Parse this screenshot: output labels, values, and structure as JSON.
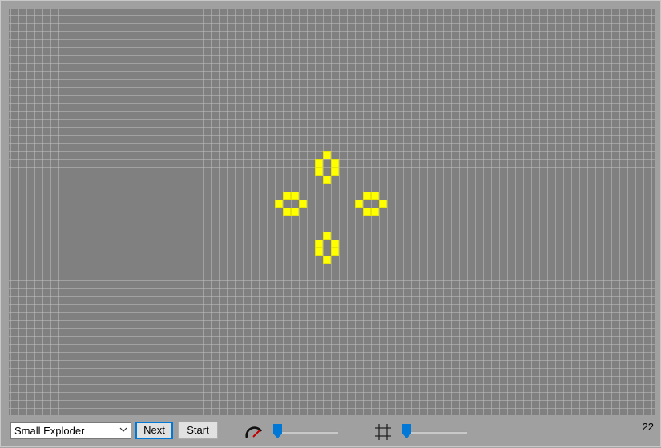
{
  "board": {
    "live_cell_color": "#ffff00",
    "background_color": "#808080",
    "grid_line_color": "#bebebe",
    "live_cells": [
      [
        40,
        18
      ],
      [
        39,
        19
      ],
      [
        41,
        19
      ],
      [
        39,
        20
      ],
      [
        41,
        20
      ],
      [
        40,
        21
      ],
      [
        35,
        23
      ],
      [
        36,
        23
      ],
      [
        45,
        23
      ],
      [
        46,
        23
      ],
      [
        34,
        24
      ],
      [
        37,
        24
      ],
      [
        44,
        24
      ],
      [
        47,
        24
      ],
      [
        35,
        25
      ],
      [
        36,
        25
      ],
      [
        45,
        25
      ],
      [
        46,
        25
      ],
      [
        40,
        28
      ],
      [
        39,
        29
      ],
      [
        41,
        29
      ],
      [
        39,
        30
      ],
      [
        41,
        30
      ],
      [
        40,
        31
      ]
    ]
  },
  "controls": {
    "pattern_select_value": "Small Exploder",
    "next_label": "Next",
    "start_label": "Start",
    "speed_icon": "speedometer-icon",
    "zoom_icon": "grid-icon",
    "speed_level": 0.0,
    "zoom_level": 0.0,
    "accent_color": "#0078d7"
  },
  "status": {
    "generation": "22"
  }
}
